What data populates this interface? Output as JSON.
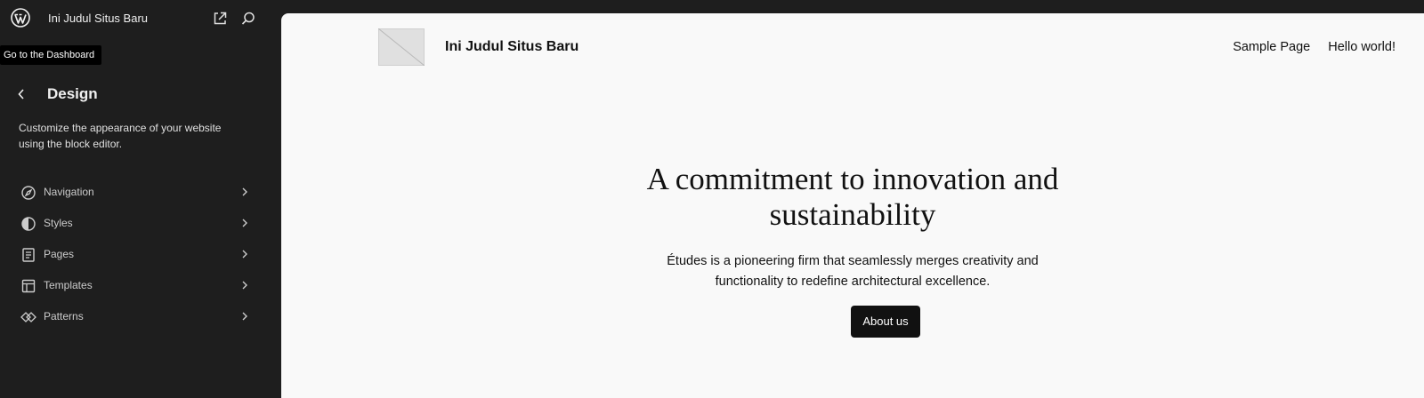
{
  "topbar": {
    "site_title": "Ini Judul Situs Baru",
    "tooltip": "Go to the Dashboard"
  },
  "design": {
    "title": "Design",
    "description": "Customize the appearance of your website using the block editor.",
    "items": [
      {
        "label": "Navigation",
        "icon": "navigation-icon"
      },
      {
        "label": "Styles",
        "icon": "styles-icon"
      },
      {
        "label": "Pages",
        "icon": "pages-icon"
      },
      {
        "label": "Templates",
        "icon": "templates-icon"
      },
      {
        "label": "Patterns",
        "icon": "patterns-icon"
      }
    ]
  },
  "preview": {
    "site_title": "Ini Judul Situs Baru",
    "nav": [
      "Sample Page",
      "Hello world!"
    ],
    "hero_heading_line1": "A commitment to innovation and",
    "hero_heading_line2": "sustainability",
    "hero_text_line1": "Études is a pioneering firm that seamlessly merges creativity and",
    "hero_text_line2": "functionality to redefine architectural excellence.",
    "button_label": "About us"
  },
  "colors": {
    "sidebar_bg": "#1e1e1e",
    "preview_bg": "#f9f9f9",
    "button_bg": "#111111"
  }
}
